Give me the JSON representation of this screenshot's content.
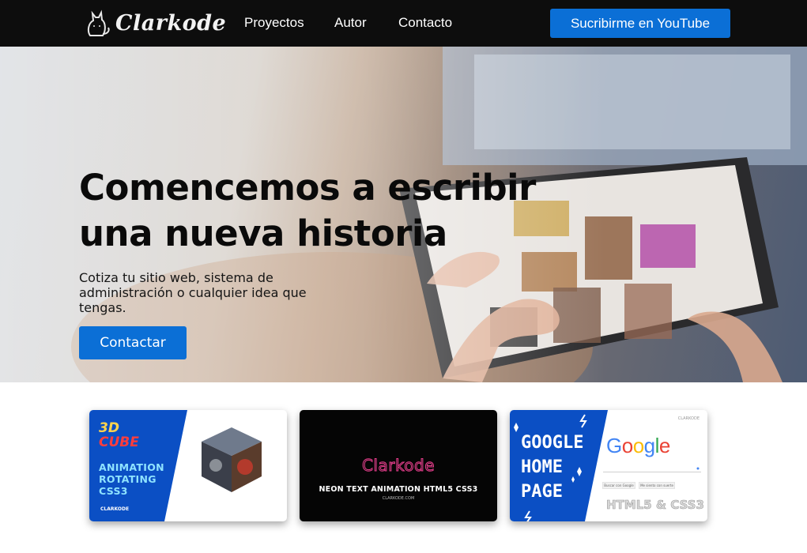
{
  "brand": {
    "name": "Clarkode"
  },
  "nav": {
    "links": [
      "Proyectos",
      "Autor",
      "Contacto"
    ],
    "cta_label": "Sucribirme en YouTube"
  },
  "hero": {
    "title_line1": "Comencemos a escribir",
    "title_line2": "una nueva historia",
    "subtitle": "Cotiza tu sitio web, sistema de administración o cualquier idea que tengas.",
    "button_label": "Contactar"
  },
  "cards": [
    {
      "line1": "3D",
      "line2": "CUBE",
      "line3": "ANIMATION ROTATING CSS3",
      "footer": "CLARKODE"
    },
    {
      "brand": "Clarkode",
      "title": "NEON TEXT ANIMATION HTML5 CSS3",
      "url": "CLARKODE.COM"
    },
    {
      "title": "GOOGLE HOME PAGE",
      "logo_letters": [
        "G",
        "o",
        "o",
        "g",
        "l",
        "e"
      ],
      "button1": "Buscar con Google",
      "button2": "Me siento con suerte",
      "footer": "HTML5 & CSS3",
      "corner": "CLARKODE"
    }
  ],
  "colors": {
    "nav_bg": "#0d0d0d",
    "accent": "#0b6fd6",
    "card_blue": "#0b4fc4",
    "google": [
      "#4285f4",
      "#ea4335",
      "#fbbc05",
      "#4285f4",
      "#34a853",
      "#ea4335"
    ]
  }
}
